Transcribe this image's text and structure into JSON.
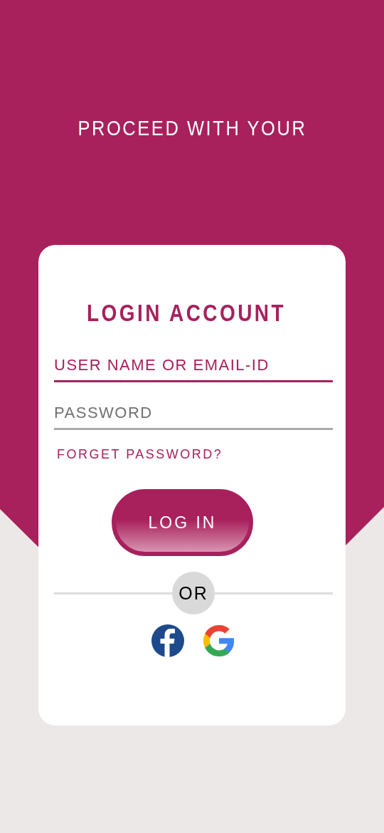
{
  "header": {
    "title": "PROCEED WITH YOUR"
  },
  "card": {
    "title": "LOGIN ACCOUNT",
    "fields": [
      {
        "placeholder": "USER NAME OR EMAIL-ID",
        "focused": true
      },
      {
        "placeholder": "PASSWORD",
        "focused": false
      }
    ],
    "forgot_link": "FORGET PASSWORD?",
    "login_button": "LOG IN",
    "divider": "OR",
    "social": [
      {
        "kind": "facebook"
      },
      {
        "kind": "google"
      }
    ]
  }
}
